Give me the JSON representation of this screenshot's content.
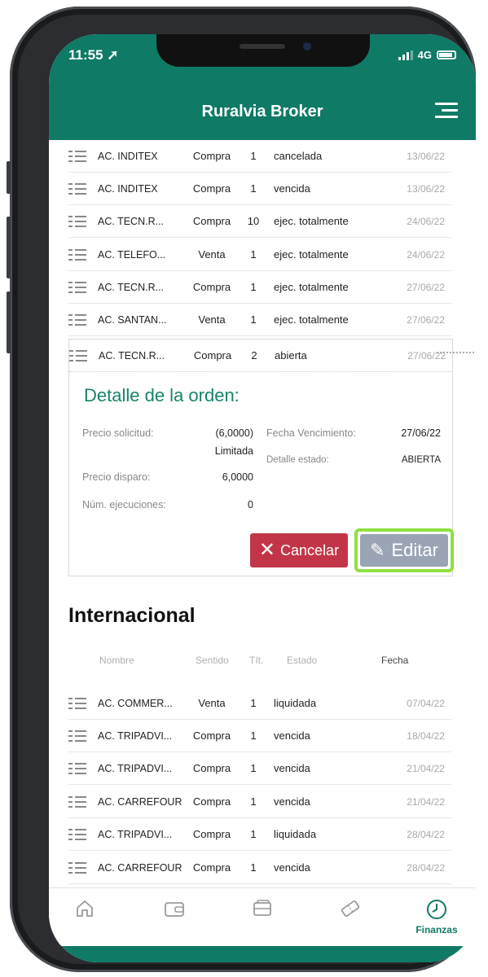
{
  "status_bar": {
    "time": "11:55",
    "network": "4G"
  },
  "header": {
    "title": "Ruralvia Broker"
  },
  "national_orders": [
    {
      "name": "AC. INDITEX",
      "sentido": "Compra",
      "titulos": "1",
      "estado": "cancelada",
      "fecha": "13/06/22"
    },
    {
      "name": "AC. INDITEX",
      "sentido": "Compra",
      "titulos": "1",
      "estado": "vencida",
      "fecha": "13/06/22"
    },
    {
      "name": "AC. TECN.R...",
      "sentido": "Compra",
      "titulos": "10",
      "estado": "ejec. totalmente",
      "fecha": "24/06/22"
    },
    {
      "name": "AC. TELEFO...",
      "sentido": "Venta",
      "titulos": "1",
      "estado": "ejec. totalmente",
      "fecha": "24/06/22"
    },
    {
      "name": "AC. TECN.R...",
      "sentido": "Compra",
      "titulos": "1",
      "estado": "ejec. totalmente",
      "fecha": "27/06/22"
    },
    {
      "name": "AC. SANTAN...",
      "sentido": "Venta",
      "titulos": "1",
      "estado": "ejec. totalmente",
      "fecha": "27/06/22"
    }
  ],
  "selected_order": {
    "name": "AC. TECN.R...",
    "sentido": "Compra",
    "titulos": "2",
    "estado": "abierta",
    "fecha": "27/06/22"
  },
  "detail": {
    "title": "Detalle de la orden:",
    "precio_solicitud_label": "Precio solicitud:",
    "precio_solicitud_value": "(6,0000)",
    "precio_solicitud_type": "Limitada",
    "precio_disparo_label": "Precio disparo:",
    "precio_disparo_value": "6,0000",
    "num_ejecuciones_label": "Núm. ejecuciones:",
    "num_ejecuciones_value": "0",
    "fecha_vencimiento_label": "Fecha Vencimiento:",
    "fecha_vencimiento_value": "27/06/22",
    "detalle_estado_label": "Detalle estado:",
    "detalle_estado_value": "ABIERTA",
    "cancel_label": "Cancelar",
    "edit_label": "Editar"
  },
  "international": {
    "title": "Internacional",
    "headers": {
      "nombre": "Nombre",
      "sentido": "Sentido",
      "tit": "Tít.",
      "estado": "Estado",
      "fecha": "Fecha"
    },
    "orders": [
      {
        "name": "AC. COMMER...",
        "sentido": "Venta",
        "titulos": "1",
        "estado": "liquidada",
        "fecha": "07/04/22"
      },
      {
        "name": "AC. TRIPADVI...",
        "sentido": "Compra",
        "titulos": "1",
        "estado": "vencida",
        "fecha": "18/04/22"
      },
      {
        "name": "AC. TRIPADVI...",
        "sentido": "Compra",
        "titulos": "1",
        "estado": "vencida",
        "fecha": "21/04/22"
      },
      {
        "name": "AC. CARREFOUR",
        "sentido": "Compra",
        "titulos": "1",
        "estado": "vencida",
        "fecha": "21/04/22"
      },
      {
        "name": "AC. TRIPADVI...",
        "sentido": "Compra",
        "titulos": "1",
        "estado": "liquidada",
        "fecha": "28/04/22"
      },
      {
        "name": "AC. CARREFOUR",
        "sentido": "Compra",
        "titulos": "1",
        "estado": "vencida",
        "fecha": "28/04/22"
      }
    ]
  },
  "tabbar": {
    "tabs": [
      {
        "icon": "home-icon",
        "label": ""
      },
      {
        "icon": "wallet-icon",
        "label": ""
      },
      {
        "icon": "card-icon",
        "label": ""
      },
      {
        "icon": "ticket-icon",
        "label": ""
      },
      {
        "icon": "clock-icon",
        "label": "Finanzas"
      }
    ]
  },
  "colors": {
    "brand": "#0f7a66",
    "cancel": "#c23548",
    "edit": "#9aa4b4",
    "highlight": "#8fe040"
  }
}
